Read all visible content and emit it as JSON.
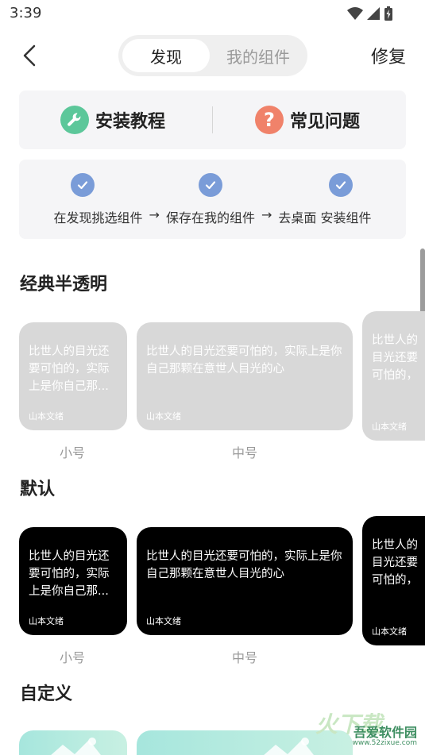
{
  "status": {
    "time": "3:39"
  },
  "header": {
    "tabs": [
      {
        "label": "发现",
        "active": true
      },
      {
        "label": "我的组件",
        "active": false
      }
    ],
    "action_label": "修复"
  },
  "help": {
    "tutorial_label": "安装教程",
    "faq_label": "常见问题",
    "faq_glyph": "?"
  },
  "steps": {
    "step1": "在发现挑选组件",
    "step2": "保存在我的组件",
    "step3": "去桌面 安装组件",
    "arrow": "→"
  },
  "sections": {
    "classic": {
      "title": "经典半透明",
      "small_text": "比世人的目光还要可怕的，实际上是你自己那...",
      "medium_text": "比世人的目光还要可怕的，实际上是你自己那颗在意世人目光的心",
      "large_text": "比世人的目光还要可怕的，实际上是你自己那颗在意世人目光的心",
      "author": "山本文绪",
      "small_label": "小号",
      "medium_label": "中号"
    },
    "default": {
      "title": "默认",
      "small_text": "比世人的目光还要可怕的，实际上是你自己那...",
      "medium_text": "比世人的目光还要可怕的，实际上是你自己那颗在意世人目光的心",
      "large_text": "比世人的目光还要可怕的，实际上是你自己那颗在意世人目光的心",
      "author": "山本文绪",
      "small_label": "小号",
      "medium_label": "中号"
    },
    "custom": {
      "title": "自定义"
    }
  },
  "watermark": {
    "name": "吾爱软件园",
    "url": "www.52zixue.com",
    "glyph": "火下载"
  },
  "colors": {
    "accent_check": "#7a9cd8",
    "tutorial_icon": "#5cc79a",
    "faq_icon": "#f0826a",
    "widget_light": "#d8d8d8",
    "widget_dark": "#000000"
  }
}
